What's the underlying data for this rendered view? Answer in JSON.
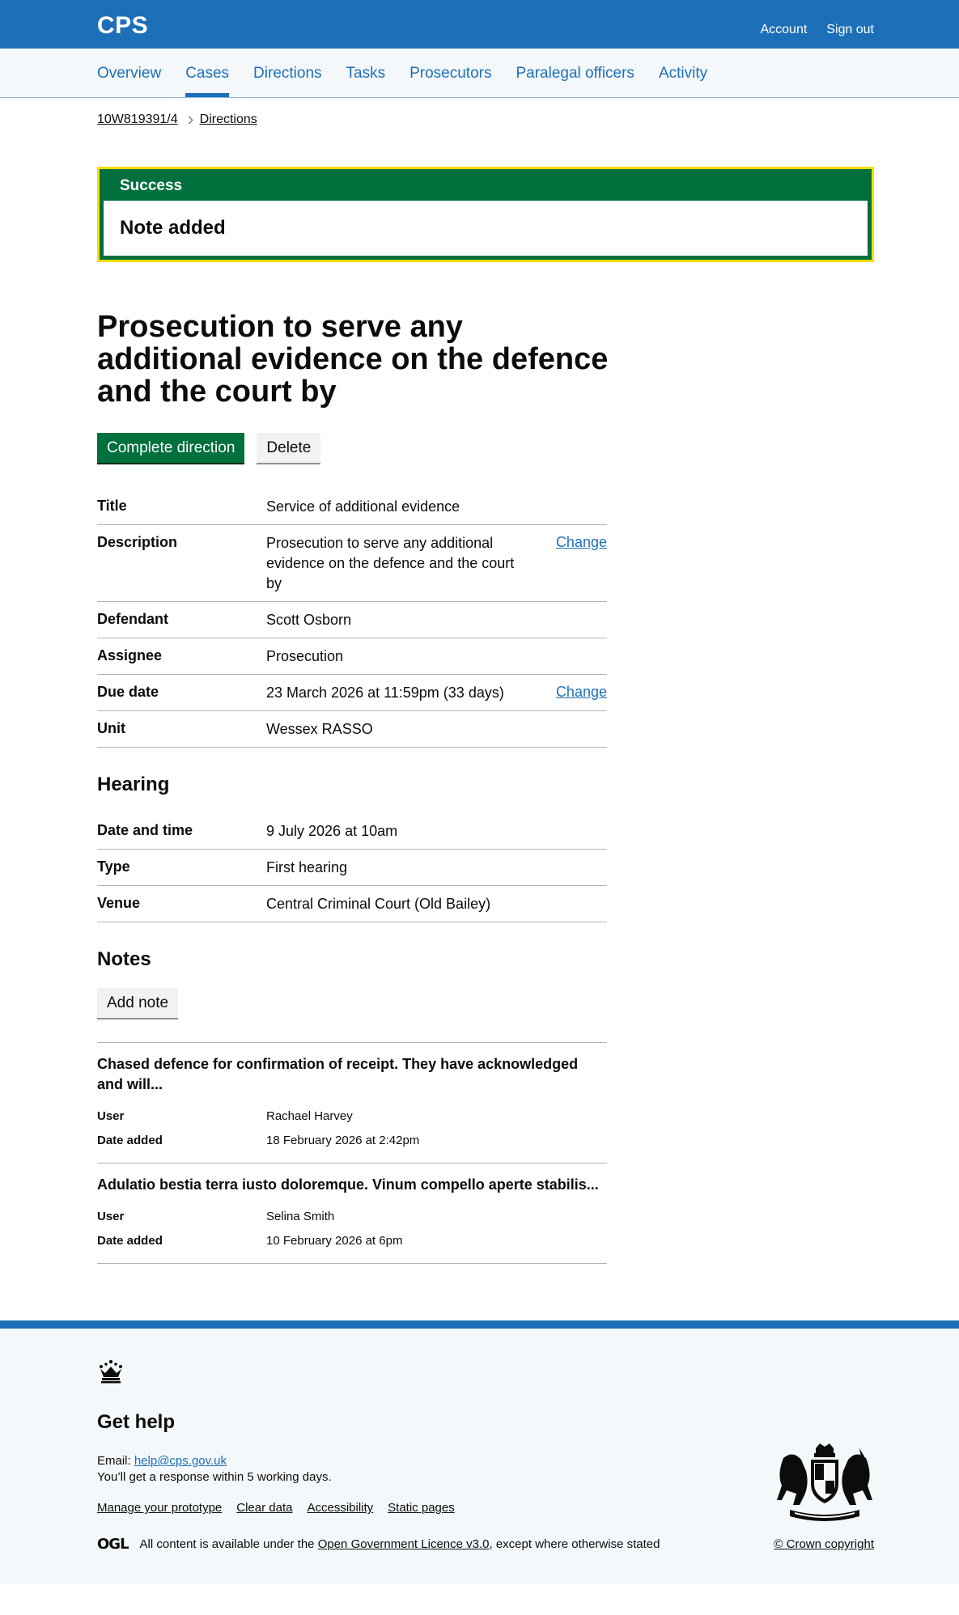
{
  "header": {
    "logo": "CPS",
    "account_link": "Account",
    "signout_link": "Sign out"
  },
  "nav": {
    "items": [
      {
        "label": "Overview",
        "active": false
      },
      {
        "label": "Cases",
        "active": true
      },
      {
        "label": "Directions",
        "active": false
      },
      {
        "label": "Tasks",
        "active": false
      },
      {
        "label": "Prosecutors",
        "active": false
      },
      {
        "label": "Paralegal officers",
        "active": false
      },
      {
        "label": "Activity",
        "active": false
      }
    ]
  },
  "breadcrumbs": {
    "case_ref": "10W819391/4",
    "current": "Directions"
  },
  "banner": {
    "title": "Success",
    "message": "Note added"
  },
  "page": {
    "title": "Prosecution to serve any additional evidence on the defence and the court by",
    "complete_button": "Complete direction",
    "delete_button": "Delete"
  },
  "details": {
    "title_key": "Title",
    "title_value": "Service of additional evidence",
    "description_key": "Description",
    "description_value": "Prosecution to serve any additional evidence on the defence and the court by",
    "description_change": "Change",
    "defendant_key": "Defendant",
    "defendant_value": "Scott Osborn",
    "assignee_key": "Assignee",
    "assignee_value": "Prosecution",
    "due_key": "Due date",
    "due_value": "23 March 2026 at 11:59pm (33 days)",
    "due_change": "Change",
    "unit_key": "Unit",
    "unit_value": "Wessex RASSO"
  },
  "hearing": {
    "heading": "Hearing",
    "datetime_key": "Date and time",
    "datetime_value": "9 July 2026 at 10am",
    "type_key": "Type",
    "type_value": "First hearing",
    "venue_key": "Venue",
    "venue_value": "Central Criminal Court (Old Bailey)"
  },
  "notes": {
    "heading": "Notes",
    "add_button": "Add note",
    "items": [
      {
        "text": "Chased defence for confirmation of receipt. They have acknowledged and will...",
        "user_key": "User",
        "user": "Rachael Harvey",
        "date_key": "Date added",
        "date": "18 February 2026 at 2:42pm"
      },
      {
        "text": "Adulatio bestia terra iusto doloremque. Vinum compello aperte stabilis...",
        "user_key": "User",
        "user": "Selina Smith",
        "date_key": "Date added",
        "date": "10 February 2026 at 6pm"
      }
    ]
  },
  "footer": {
    "heading": "Get help",
    "email_label": "Email: ",
    "email": "help@cps.gov.uk",
    "response": "You’ll get a response within 5 working days.",
    "links": [
      "Manage your prototype",
      "Clear data",
      "Accessibility",
      "Static pages"
    ],
    "ogl": "OGL",
    "licence_prefix": "All content is available under the ",
    "licence_link": "Open Government Licence v3.0",
    "licence_suffix": ", except where otherwise stated",
    "copyright": "© Crown copyright"
  }
}
